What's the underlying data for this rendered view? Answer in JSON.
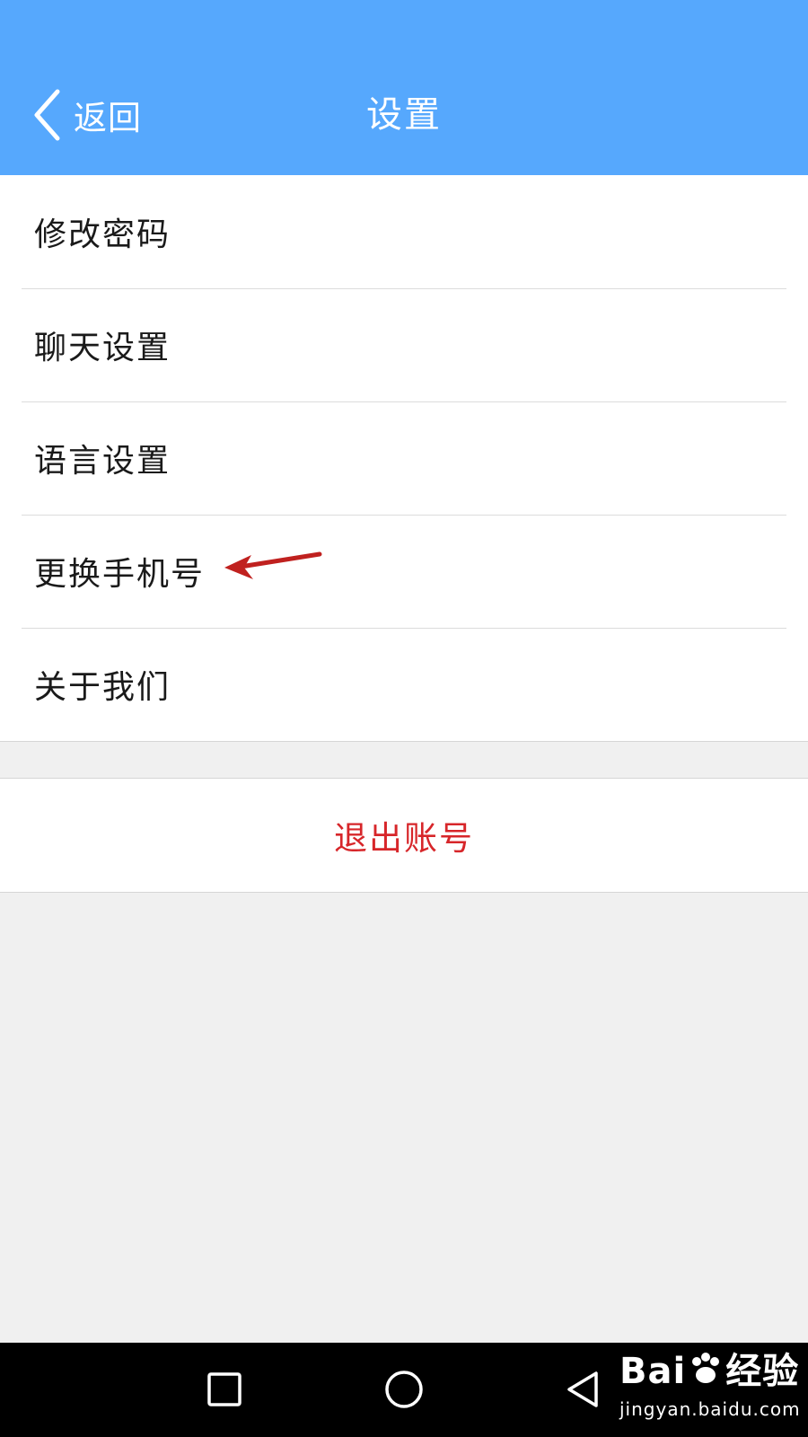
{
  "header": {
    "back_label": "返回",
    "title": "设置",
    "bg_color": "#56a8fd"
  },
  "menu": {
    "items": [
      {
        "label": "修改密码"
      },
      {
        "label": "聊天设置"
      },
      {
        "label": "语言设置"
      },
      {
        "label": "更换手机号",
        "annotated_with": "red-arrow-icon"
      },
      {
        "label": "关于我们"
      }
    ]
  },
  "logout": {
    "label": "退出账号",
    "color": "#d7262a"
  },
  "navbar": {
    "buttons": [
      "recents-square-icon",
      "home-circle-icon",
      "back-triangle-icon"
    ]
  },
  "watermark": {
    "brand_pre": "Bai",
    "brand_post": "经验",
    "url": "jingyan.baidu.com"
  },
  "colors": {
    "page_bg": "#f0f0f0",
    "annotation_arrow": "#c0211f"
  }
}
